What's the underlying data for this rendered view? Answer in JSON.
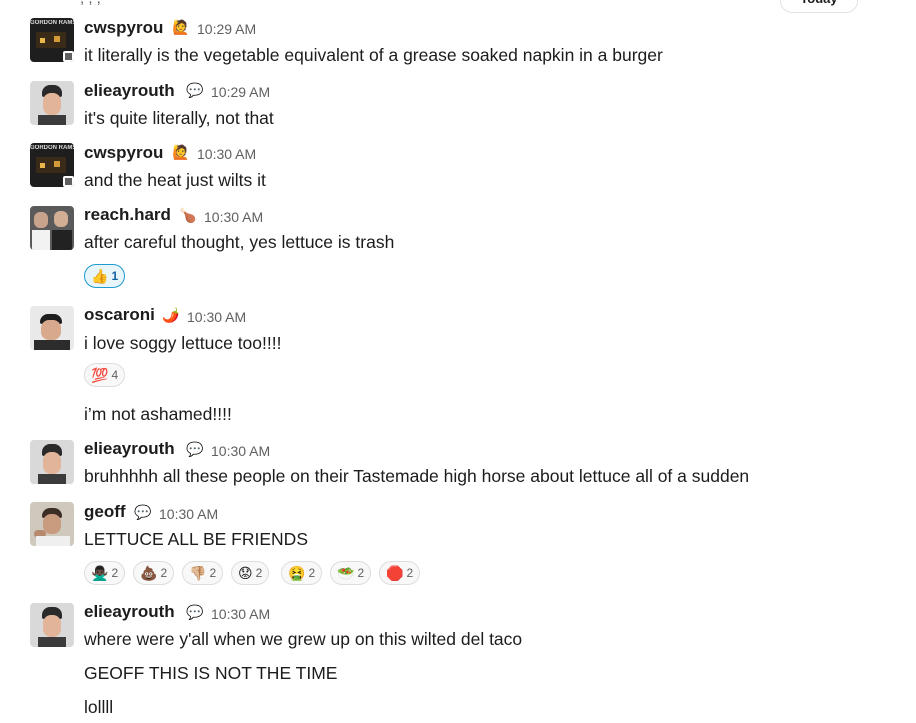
{
  "top_fragment": ", , ,",
  "divider_label": "Today",
  "messages": [
    {
      "user": "cwspyrou",
      "status": "🙋",
      "time": "10:29 AM",
      "text": "it literally is the vegetable equivalent of a grease soaked napkin in a burger",
      "avatar_text": "GORDON RAMSAY"
    },
    {
      "user": "elieayrouth",
      "status": "💬",
      "time": "10:29 AM",
      "text": "it's quite literally, not that"
    },
    {
      "user": "cwspyrou",
      "status": "🙋",
      "time": "10:30 AM",
      "text": "and the heat just wilts it",
      "avatar_text": "GORDON RAMSAY"
    },
    {
      "user": "reach.hard",
      "status": "🍗",
      "time": "10:30 AM",
      "text": "after careful thought, yes lettuce is trash",
      "reactions": [
        {
          "emoji": "👍",
          "count": "1"
        }
      ]
    },
    {
      "user": "oscaroni",
      "status": "🌶️",
      "time": "10:30 AM",
      "text": "i love soggy lettuce too!!!!",
      "reactions": [
        {
          "emoji": "💯",
          "count": "4"
        }
      ],
      "extra": [
        "i’m not ashamed!!!!"
      ]
    },
    {
      "user": "elieayrouth",
      "status": "💬",
      "time": "10:30 AM",
      "text": "bruhhhhh all these people on their Tastemade high horse about lettuce all of a sudden"
    },
    {
      "user": "geoff",
      "status": "💬",
      "time": "10:30 AM",
      "text": "LETTUCE ALL BE FRIENDS",
      "reactions": [
        {
          "emoji": "🙅🏿‍♂️",
          "count": "2"
        },
        {
          "emoji": "💩",
          "count": "2"
        },
        {
          "emoji": "👎🏼",
          "count": "2"
        },
        {
          "emoji": "😟",
          "count": "2"
        },
        {
          "emoji": "🤮",
          "count": "2"
        },
        {
          "emoji": "🥗",
          "count": "2"
        },
        {
          "emoji": "🛑",
          "count": "2"
        }
      ]
    },
    {
      "user": "elieayrouth",
      "status": "💬",
      "time": "10:30 AM",
      "text": "where were y'all when we grew up on this wilted del taco",
      "extra": [
        "GEOFF THIS IS NOT THE TIME",
        "lollll"
      ]
    }
  ]
}
